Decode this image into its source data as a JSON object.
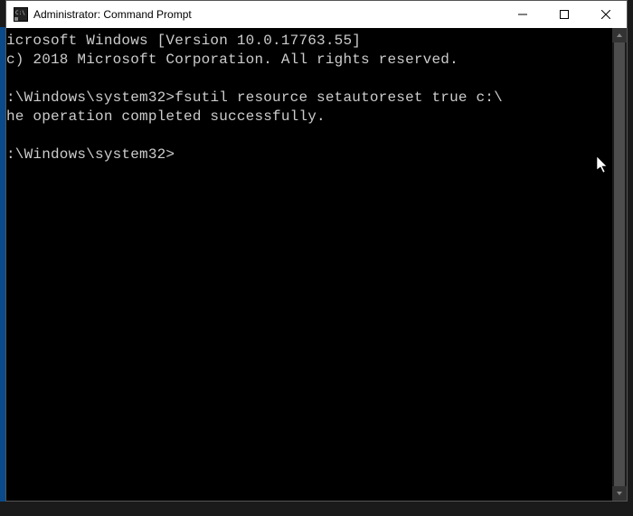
{
  "window": {
    "title": "Administrator: Command Prompt"
  },
  "terminal": {
    "line1": "icrosoft Windows [Version 10.0.17763.55]",
    "line2": "c) 2018 Microsoft Corporation. All rights reserved.",
    "line3": "",
    "line4_prompt": ":\\Windows\\system32>",
    "line4_cmd": "fsutil resource setautoreset true c:\\",
    "line5": "he operation completed successfully.",
    "line6": "",
    "line7_prompt": ":\\Windows\\system32>"
  }
}
